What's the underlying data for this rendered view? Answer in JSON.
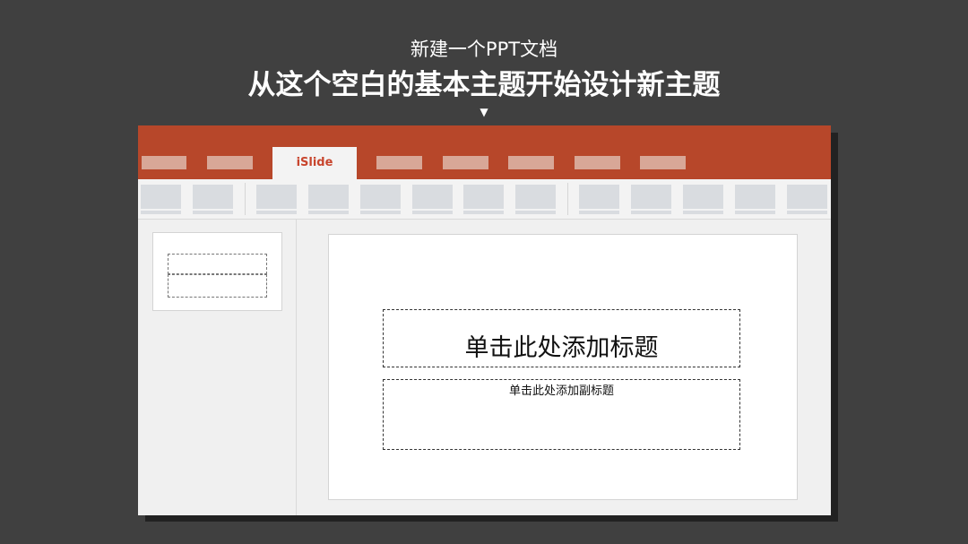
{
  "heading": {
    "subtitle": "新建一个PPT文档",
    "title": "从这个空白的基本主题开始设计新主题",
    "pointer_glyph": "▼"
  },
  "ribbon_tabs": {
    "active_label": "iSlide",
    "accent_color": "#b7472a"
  },
  "slide": {
    "title_placeholder": "单击此处添加标题",
    "subtitle_placeholder": "单击此处添加副标题"
  }
}
